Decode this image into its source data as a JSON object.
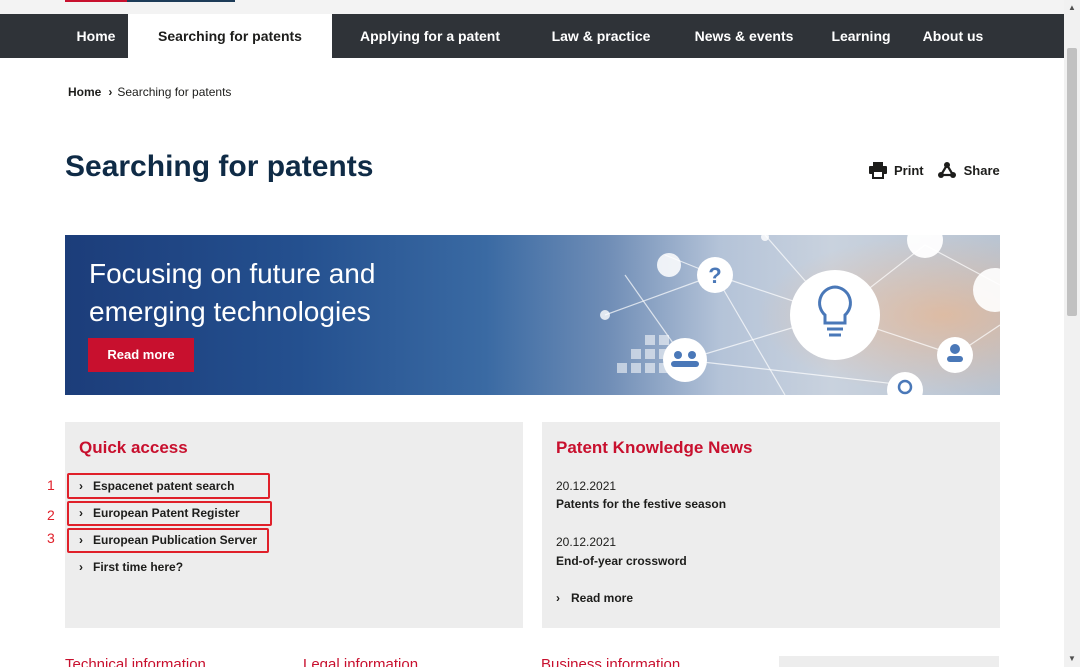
{
  "nav": {
    "items": [
      {
        "label": "Home",
        "active": false
      },
      {
        "label": "Searching for patents",
        "active": true
      },
      {
        "label": "Applying for a patent",
        "active": false
      },
      {
        "label": "Law & practice",
        "active": false
      },
      {
        "label": "News & events",
        "active": false
      },
      {
        "label": "Learning",
        "active": false
      },
      {
        "label": "About us",
        "active": false
      }
    ]
  },
  "breadcrumb": {
    "home": "Home",
    "current": "Searching for patents"
  },
  "page": {
    "title": "Searching for patents"
  },
  "tools": {
    "print": "Print",
    "share": "Share"
  },
  "banner": {
    "title": "Focusing on future and emerging technologies",
    "button": "Read more"
  },
  "quick_access": {
    "title": "Quick access",
    "links": [
      {
        "label": "Espacenet patent search",
        "marker": "1"
      },
      {
        "label": "European Patent Register",
        "marker": "2"
      },
      {
        "label": "European Publication Server",
        "marker": "3"
      },
      {
        "label": "First time here?",
        "marker": ""
      }
    ]
  },
  "news": {
    "title": "Patent Knowledge News",
    "items": [
      {
        "date": "20.12.2021",
        "title": "Patents for the festive season"
      },
      {
        "date": "20.12.2021",
        "title": "End-of-year crossword"
      }
    ],
    "more": "Read more"
  },
  "bottom_headings": [
    "Technical information",
    "Legal information",
    "Business information"
  ],
  "colors": {
    "accent": "#c8102e",
    "nav_bg": "#2f3338",
    "title": "#0f2b46",
    "panel_bg": "#ededed",
    "highlight": "#e0202a"
  }
}
